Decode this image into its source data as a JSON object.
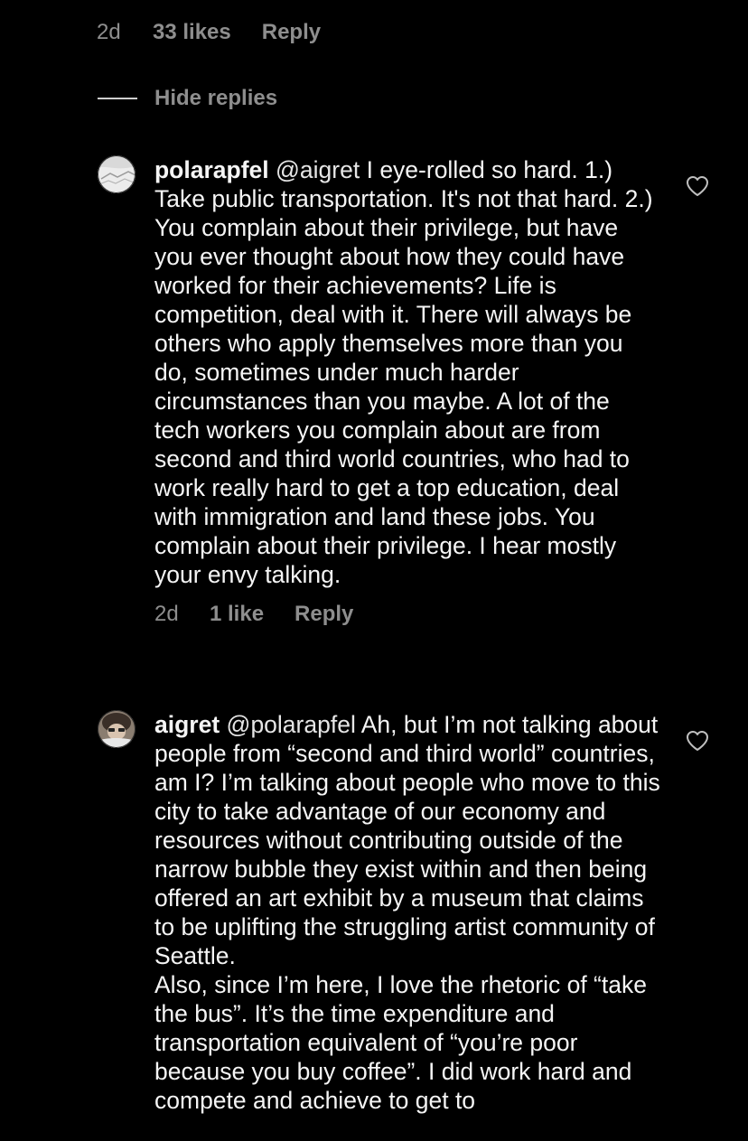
{
  "parent_meta": {
    "time": "2d",
    "likes": "33 likes",
    "reply": "Reply"
  },
  "hide_replies": {
    "label": "Hide replies"
  },
  "comments": [
    {
      "username": "polarapfel",
      "mention": "@aigret",
      "text": "I eye-rolled so hard. 1.) Take public transportation. It's not that hard. 2.) You complain about their privilege, but have you ever thought about how they could have worked for their achievements? Life is competition, deal with it. There will always be others who apply themselves more than you do, sometimes under much harder circumstances than you maybe. A lot of the tech workers you complain about are from second and third world countries, who had to work really hard to get a top education, deal with immigration and land these jobs. You complain about their privilege. I hear mostly your envy talking.",
      "time": "2d",
      "likes": "1 like",
      "reply": "Reply",
      "like_icon": "heart-outline-icon"
    },
    {
      "username": "aigret",
      "mention": "@polarapfel",
      "text": "Ah, but I’m not talking about people from “second and third world” countries, am I? I’m talking about people who move to this city to take advantage of our economy and resources without contributing outside of the narrow bubble they exist within and then being offered an art exhibit by a museum that claims to be uplifting the struggling artist community of Seattle.",
      "text2": "Also, since I’m here, I love the rhetoric of “take the bus”. It’s the time expenditure and transportation equivalent of “you’re poor because you buy coffee”. I did work hard and compete and achieve to get to",
      "like_icon": "heart-outline-icon"
    }
  ],
  "colors": {
    "background": "#000000",
    "text": "#f5f5f5",
    "muted": "#8e8e8e"
  }
}
